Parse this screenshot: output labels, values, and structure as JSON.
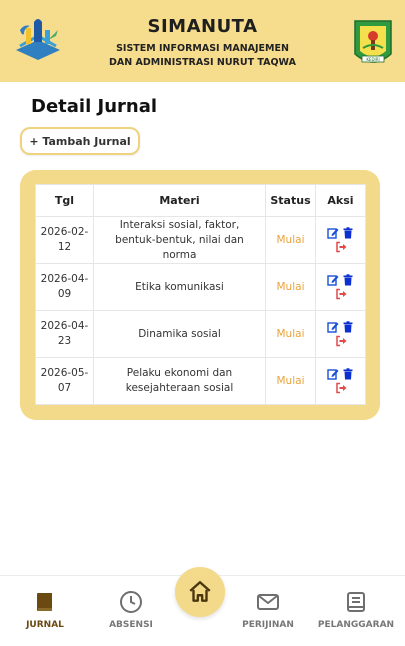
{
  "header": {
    "title": "SIMANUTA",
    "subtitle_line1": "SISTEM INFORMASI MANAJEMEN",
    "subtitle_line2": "DAN ADMINISTRASI NURUT TAQWA",
    "right_logo_caption": "KEDIRI"
  },
  "page": {
    "title": "Detail Jurnal",
    "add_button_label": "+ Tambah Jurnal"
  },
  "table": {
    "columns": [
      "Tgl",
      "Materi",
      "Status",
      "Aksi"
    ],
    "rows": [
      {
        "tgl": "2026-02-12",
        "materi": "Interaksi sosial, faktor, bentuk-bentuk, nilai dan norma",
        "status": "Mulai"
      },
      {
        "tgl": "2026-04-09",
        "materi": "Etika komunikasi",
        "status": "Mulai"
      },
      {
        "tgl": "2026-04-23",
        "materi": "Dinamika sosial",
        "status": "Mulai"
      },
      {
        "tgl": "2026-05-07",
        "materi": "Pelaku ekonomi dan kesejahteraan sosial",
        "status": "Mulai"
      }
    ],
    "action_icons": [
      "edit-icon",
      "delete-icon",
      "logout-icon"
    ]
  },
  "nav": {
    "items": [
      {
        "label": "JURNAL",
        "icon": "journal-icon",
        "active": true
      },
      {
        "label": "ABSENSI",
        "icon": "clock-icon",
        "active": false
      },
      {
        "label": "PERIJINAN",
        "icon": "mail-icon",
        "active": false
      },
      {
        "label": "PELANGGARAN",
        "icon": "book-icon",
        "active": false
      }
    ],
    "home_icon": "home-icon"
  },
  "colors": {
    "header_bg": "#f6dc8d",
    "card_bg": "#f3d98a",
    "status_text": "#e8a33d",
    "edit_icon": "#1a4fd6",
    "delete_icon": "#0b2fd1",
    "logout_icon": "#e24a4a",
    "active_nav": "#6b4a12"
  }
}
